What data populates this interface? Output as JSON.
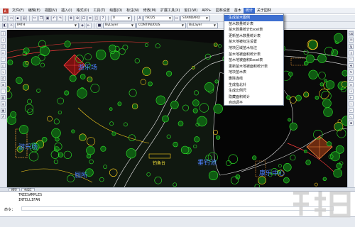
{
  "menubar": {
    "items": [
      "文件(F)",
      "编辑(E)",
      "视图(V)",
      "插入(I)",
      "格式(O)",
      "工具(T)",
      "绘图(D)",
      "标注(N)",
      "修改(M)",
      "扩展工具(X)",
      "窗口(W)",
      "APP+",
      "园林设置",
      "苗木",
      "统计",
      "关于园林"
    ],
    "active_index": 14
  },
  "toolbar2": {
    "layer_combo": "0",
    "style_combo_1": "ISO25",
    "style_combo_2": "STANDARD"
  },
  "toolbar3": {
    "path_combo": "PATH",
    "bylayer_color": "ByLayer",
    "linetype": "CONTINUOUS"
  },
  "dropdown": {
    "items": [
      "生成苗木图例",
      "苗木数量统计表",
      "苗木数量统计Excel表",
      "更新苗木数量统计表",
      "苗木地被标注设置",
      "地块区域苗木标注",
      "苗木地被面积统计表",
      "苗木地被面积Excel表",
      "更新苗木地被面积统计表",
      "地块苗木表",
      "删除连线",
      "生成指北针",
      "生成比例尺",
      "隐藏面积统计",
      "自动调平"
    ],
    "selected_index": 0
  },
  "drawing": {
    "labels": {
      "top_left": "游乐场",
      "mid_left": "游乐场",
      "pond": "垂钓池",
      "bridge": "钓鱼台",
      "toilet": "厕所",
      "center": "康乐中心"
    }
  },
  "tabs": [
    "模型",
    "布局1"
  ],
  "command": {
    "lines": [
      "TREESAMPLES",
      "INTELLIFAN"
    ],
    "prompt": "命令:"
  },
  "colors": {
    "canvas": "#0a0a0a",
    "plants": "#22c21f",
    "menu_highlight": "#3d6fd0",
    "label": "#4c82ff"
  }
}
